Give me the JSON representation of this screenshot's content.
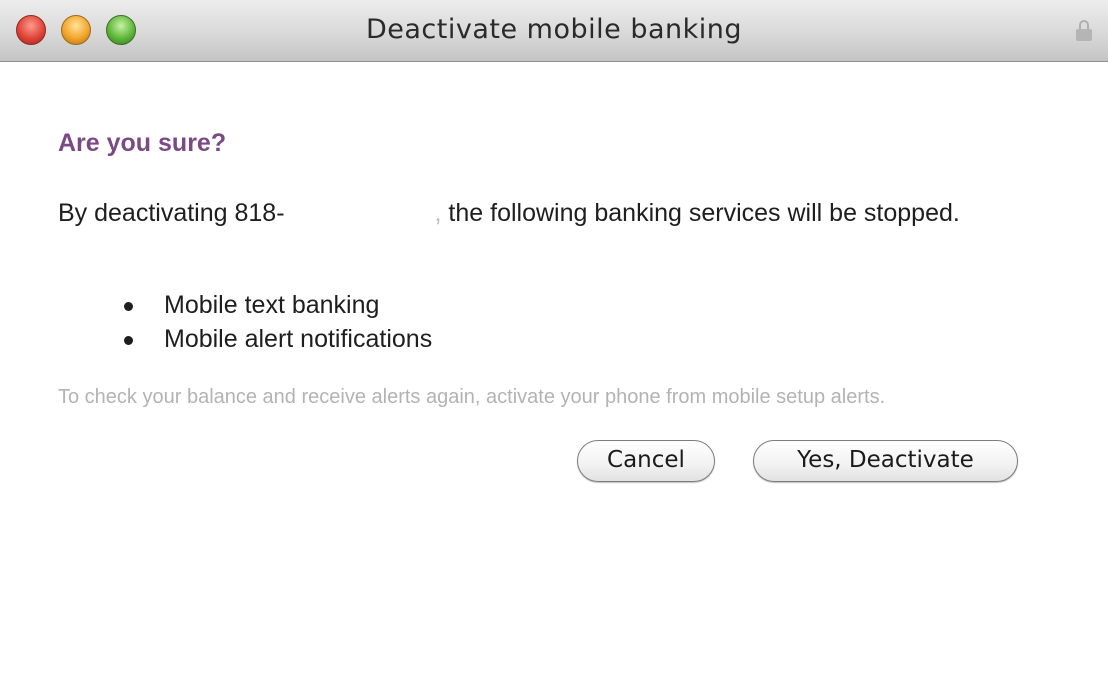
{
  "window": {
    "title": "Deactivate mobile banking",
    "controls": [
      "close-icon",
      "minimize-icon",
      "zoom-icon"
    ],
    "lock_icon": "lock-icon"
  },
  "dialog": {
    "heading": "Are you sure?",
    "intro_prefix": "By deactivating 818-",
    "intro_comma": ",",
    "intro_suffix": " the following banking services will be stopped.",
    "services": [
      "Mobile text banking",
      "Mobile alert notifications"
    ],
    "note": "To check your balance and receive alerts again, activate your phone from mobile setup alerts.",
    "cancel_label": "Cancel",
    "confirm_label": "Yes, Deactivate"
  },
  "colors": {
    "heading": "#7b4a84",
    "note": "#b3b3b3",
    "close": "#e0443a",
    "minimize": "#f2a52c",
    "zoom": "#5fb73b"
  }
}
